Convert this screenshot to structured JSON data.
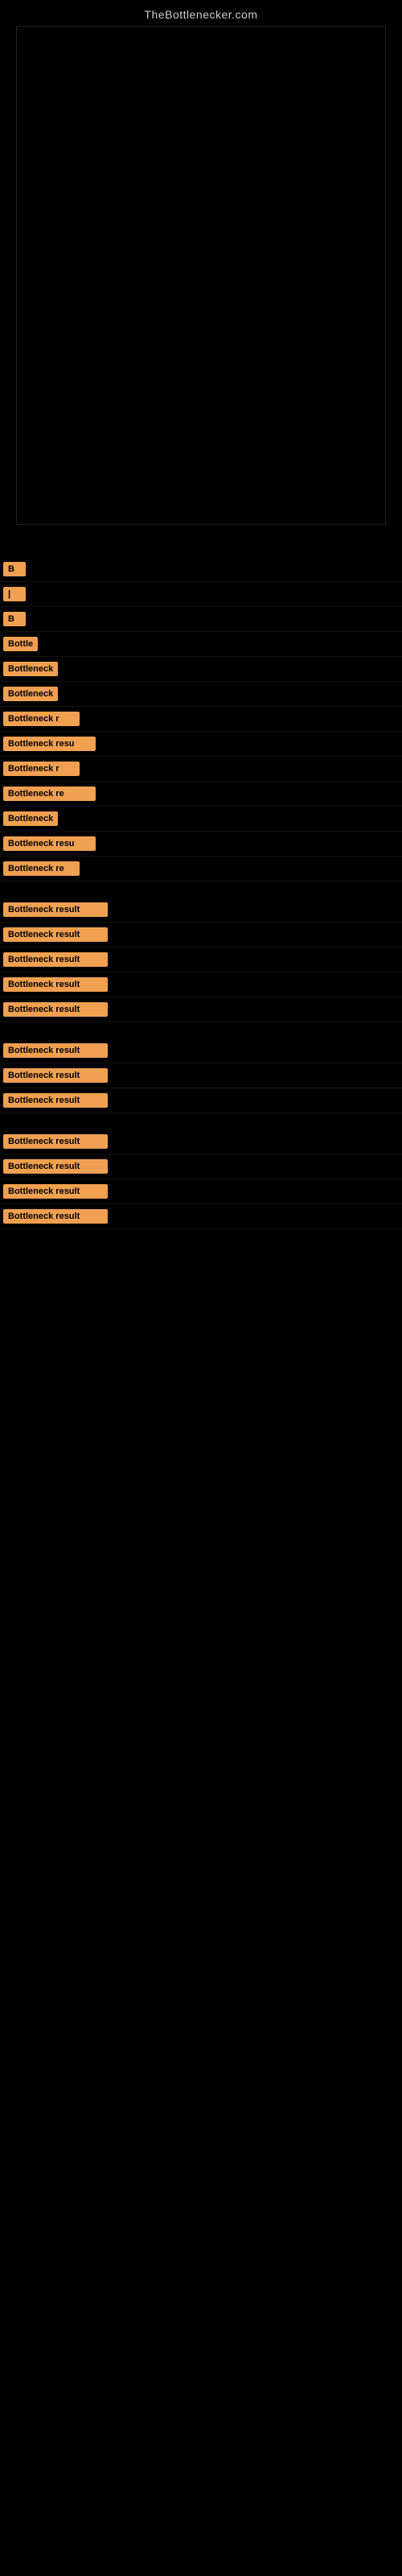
{
  "site": {
    "title": "TheBottlenecker.com"
  },
  "results": [
    {
      "id": 1,
      "text": "B",
      "size": "xs"
    },
    {
      "id": 2,
      "text": "|",
      "size": "xs"
    },
    {
      "id": 3,
      "text": "B",
      "size": "xs"
    },
    {
      "id": 4,
      "text": "Bottle",
      "size": "s"
    },
    {
      "id": 5,
      "text": "Bottleneck",
      "size": "m"
    },
    {
      "id": 6,
      "text": "Bottleneck",
      "size": "m"
    },
    {
      "id": 7,
      "text": "Bottleneck r",
      "size": "l"
    },
    {
      "id": 8,
      "text": "Bottleneck resu",
      "size": "xl"
    },
    {
      "id": 9,
      "text": "Bottleneck r",
      "size": "l"
    },
    {
      "id": 10,
      "text": "Bottleneck re",
      "size": "xl"
    },
    {
      "id": 11,
      "text": "Bottleneck",
      "size": "m"
    },
    {
      "id": 12,
      "text": "Bottleneck resu",
      "size": "xl"
    },
    {
      "id": 13,
      "text": "Bottleneck re",
      "size": "l"
    },
    {
      "id": 14,
      "text": "Bottleneck result",
      "size": "xxl"
    },
    {
      "id": 15,
      "text": "Bottleneck result",
      "size": "xxl"
    },
    {
      "id": 16,
      "text": "Bottleneck result",
      "size": "xxl"
    },
    {
      "id": 17,
      "text": "Bottleneck result",
      "size": "xxl"
    },
    {
      "id": 18,
      "text": "Bottleneck result",
      "size": "xxl"
    },
    {
      "id": 19,
      "text": "Bottleneck result",
      "size": "xxl"
    },
    {
      "id": 20,
      "text": "Bottleneck result",
      "size": "xxl"
    },
    {
      "id": 21,
      "text": "Bottleneck result",
      "size": "xxl"
    },
    {
      "id": 22,
      "text": "Bottleneck result",
      "size": "xxl"
    },
    {
      "id": 23,
      "text": "Bottleneck result",
      "size": "xxl"
    },
    {
      "id": 24,
      "text": "Bottleneck result",
      "size": "xxl"
    },
    {
      "id": 25,
      "text": "Bottleneck result",
      "size": "xxl"
    }
  ]
}
